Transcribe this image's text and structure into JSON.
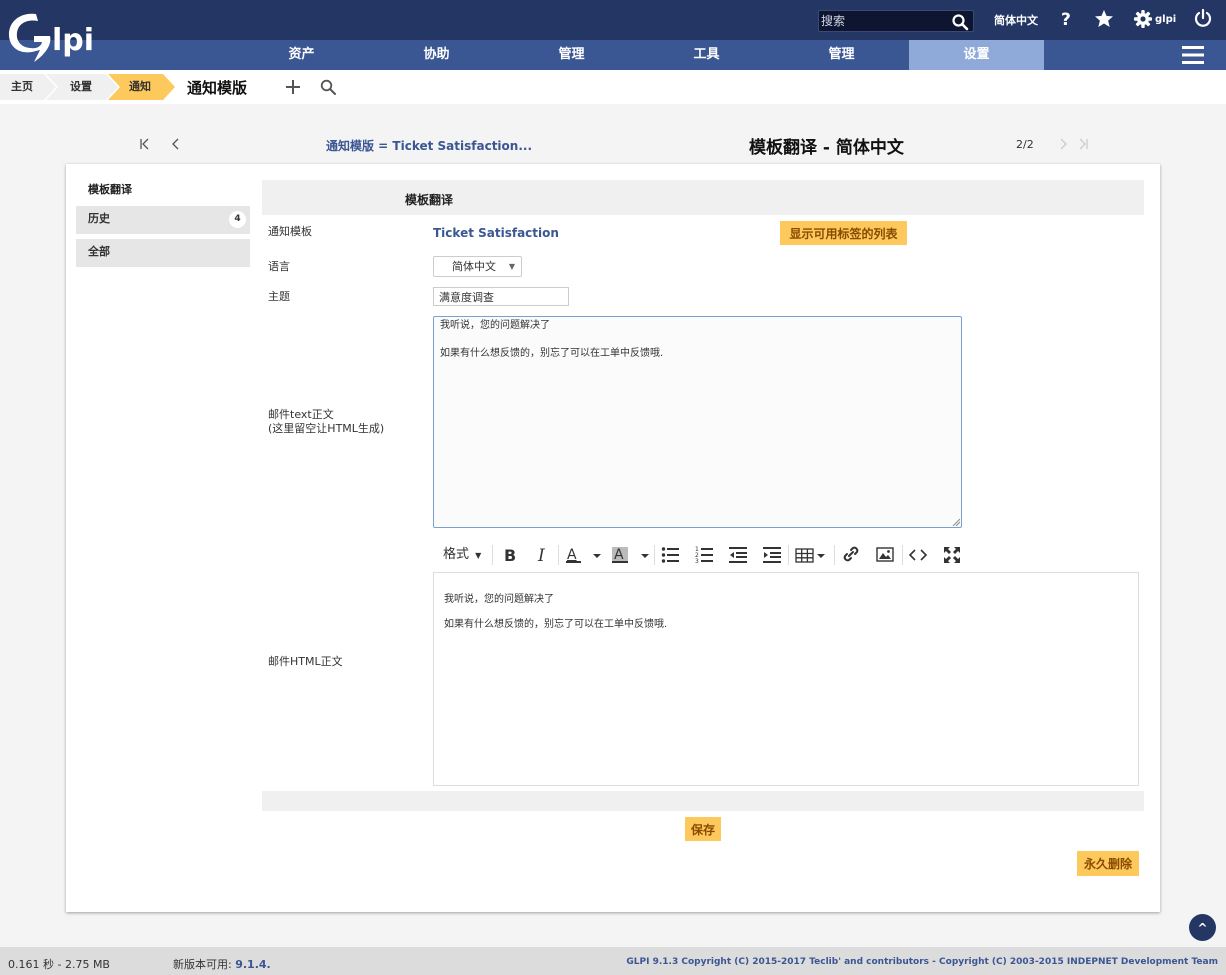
{
  "header": {
    "logo_text": "Glpi",
    "search_placeholder": "搜索",
    "language": "简体中文",
    "user": "glpi"
  },
  "menu": [
    "资产",
    "协助",
    "管理",
    "工具",
    "管理",
    "设置"
  ],
  "breadcrumb": {
    "items": [
      "主页",
      "设置",
      "通知"
    ],
    "title": "通知模版"
  },
  "nav": {
    "link": "通知模版 = Ticket Satisfaction...",
    "title": "模板翻译 - 简体中文",
    "count": "2/2"
  },
  "sidebar": {
    "title": "模板翻译",
    "tabs": [
      {
        "label": "历史",
        "badge": "4"
      },
      {
        "label": "全部"
      }
    ]
  },
  "form": {
    "section_title": "模板翻译",
    "template_label": "通知模板",
    "template_value": "Ticket Satisfaction",
    "show_tags_button": "显示可用标签的列表",
    "language_label": "语言",
    "language_value": "简体中文",
    "subject_label": "主题",
    "subject_value": "满意度调查",
    "text_label_1": "邮件text正文",
    "text_label_2": "(这里留空让HTML生成)",
    "text_line_1": "我听说，您的问题解决了",
    "text_line_2": "如果有什么想反馈的，别忘了可以在工单中反馈哦.",
    "html_label": "邮件HTML正文",
    "toolbar_format": "格式",
    "html_line_1": "我听说，您的问题解决了",
    "html_line_2": "如果有什么想反馈的，别忘了可以在工单中反馈哦.",
    "save_button": "保存",
    "delete_button": "永久删除"
  },
  "footer": {
    "timing": "0.161 秒 - 2.75 MB",
    "new_version_label": "新版本可用:",
    "new_version": "9.1.4.",
    "copyright": "GLPI 9.1.3 Copyright (C) 2015-2017 Teclib' and contributors - Copyright (C) 2003-2015 INDEPNET Development Team"
  },
  "colors": {
    "header_bg": "#243764",
    "menu_bg": "#3a5693",
    "menu_active": "#8fa9d8",
    "accent_yellow": "#fec95c",
    "link_blue": "#3a5693"
  }
}
